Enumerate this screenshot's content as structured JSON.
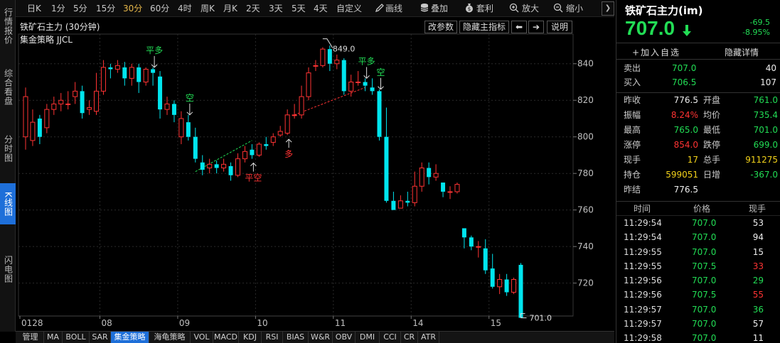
{
  "left_tabs": [
    "行情报价",
    "综合看盘",
    "分时图",
    "K线图",
    "闪电图"
  ],
  "left_tabs_active": 3,
  "toolbar": {
    "periods": [
      "日K",
      "1分",
      "5分",
      "15分",
      "30分",
      "60分",
      "4时",
      "周K",
      "月K",
      "2天",
      "3天",
      "5天",
      "4天",
      "自定义"
    ],
    "active_period": "30分",
    "draw": "画线",
    "overlay": "叠加",
    "template": "套利",
    "zoom_in": "放大",
    "zoom_out": "缩小",
    "icons": [
      "pencil-icon",
      "database-icon",
      "moneybag-icon",
      "zoom-in-icon",
      "zoom-out-icon"
    ]
  },
  "chart_header": {
    "title": "铁矿石主力 (30分钟)",
    "strategy": "集金策略 JJCL",
    "change_params": "改参数",
    "hide_indicator": "隐藏主指标",
    "help": "说明"
  },
  "chart_data": {
    "type": "candlestick",
    "y_ticks": [
      720.0,
      740.0,
      760.0,
      780.0,
      800.0,
      820.0,
      840.0
    ],
    "ylim": [
      702,
      850
    ],
    "x_ticks": [
      {
        "label": "0128",
        "index": 0
      },
      {
        "label": "08",
        "index": 11
      },
      {
        "label": "09",
        "index": 22
      },
      {
        "label": "10",
        "index": 33
      },
      {
        "label": "11",
        "index": 44
      },
      {
        "label": "14",
        "index": 55
      },
      {
        "label": "15",
        "index": 66
      }
    ],
    "candles": [
      [
        800,
        822,
        827,
        793
      ],
      [
        798,
        808,
        815,
        795
      ],
      [
        810,
        800,
        812,
        796
      ],
      [
        805,
        815,
        818,
        802
      ],
      [
        815,
        818,
        822,
        812
      ],
      [
        818,
        820,
        824,
        814
      ],
      [
        818,
        818,
        825,
        815
      ],
      [
        822,
        825,
        830,
        818
      ],
      [
        825,
        813,
        828,
        810
      ],
      [
        815,
        816,
        820,
        812
      ],
      [
        814,
        825,
        835,
        812
      ],
      [
        825,
        838,
        842,
        823
      ],
      [
        838,
        837,
        840,
        832
      ],
      [
        837,
        839,
        842,
        835
      ],
      [
        838,
        832,
        841,
        828
      ],
      [
        832,
        838,
        840,
        828
      ],
      [
        838,
        830,
        840,
        824
      ],
      [
        830,
        837,
        838,
        828
      ],
      [
        837,
        835,
        838,
        828
      ],
      [
        833,
        815,
        836,
        810
      ],
      [
        815,
        818,
        822,
        812
      ],
      [
        818,
        812,
        820,
        808
      ],
      [
        800,
        810,
        814,
        796
      ],
      [
        808,
        800,
        812,
        798
      ],
      [
        800,
        788,
        805,
        786
      ],
      [
        786,
        782,
        790,
        779
      ],
      [
        783,
        785,
        788,
        780
      ],
      [
        785,
        783,
        787,
        780
      ],
      [
        783,
        785,
        788,
        781
      ],
      [
        784,
        779,
        786,
        776
      ],
      [
        779,
        788,
        791,
        778
      ],
      [
        788,
        792,
        795,
        786
      ],
      [
        793,
        790,
        796,
        788
      ],
      [
        790,
        796,
        797,
        789
      ],
      [
        796,
        795,
        800,
        793
      ],
      [
        797,
        800,
        802,
        795
      ],
      [
        801,
        803,
        806,
        800
      ],
      [
        802,
        812,
        815,
        801
      ],
      [
        812,
        812,
        818,
        810
      ],
      [
        812,
        822,
        828,
        810
      ],
      [
        822,
        835,
        838,
        820
      ],
      [
        839,
        839,
        842,
        836
      ],
      [
        839,
        848,
        849,
        838
      ],
      [
        848,
        840,
        850,
        836
      ],
      [
        840,
        842,
        845,
        837
      ],
      [
        842,
        825,
        843,
        823
      ],
      [
        825,
        830,
        834,
        822
      ],
      [
        830,
        830,
        836,
        828
      ],
      [
        830,
        828,
        832,
        825
      ],
      [
        827,
        825,
        832,
        823
      ],
      [
        825,
        800,
        826,
        798
      ],
      [
        800,
        765,
        816,
        764
      ],
      [
        765,
        760,
        770,
        761
      ],
      [
        761,
        765,
        768,
        762
      ],
      [
        765,
        764,
        770,
        762
      ],
      [
        764,
        773,
        781,
        762
      ],
      [
        773,
        783,
        786,
        770
      ],
      [
        783,
        778,
        786,
        774
      ],
      [
        778,
        780,
        785,
        776
      ],
      [
        775,
        770,
        775,
        767
      ],
      [
        770,
        770,
        773,
        766
      ],
      [
        770,
        774,
        775,
        769
      ],
      [
        750,
        745,
        750,
        739
      ],
      [
        745,
        740,
        746,
        738
      ],
      [
        740,
        740,
        743,
        734
      ],
      [
        739,
        727,
        744,
        725
      ],
      [
        728,
        718,
        736,
        717
      ],
      [
        718,
        722,
        725,
        714
      ],
      [
        722,
        715,
        725,
        713
      ],
      [
        715,
        722,
        723,
        714
      ],
      [
        730,
        701,
        731,
        701
      ]
    ],
    "signals": [
      {
        "label": "平多",
        "index": 18,
        "price": 842,
        "type": "sell",
        "color": "#22dd55"
      },
      {
        "label": "空",
        "index": 23,
        "price": 807,
        "type": "sell",
        "color": "#22dd55"
      },
      {
        "label": "平空",
        "index": 32,
        "price": 788,
        "type": "buy",
        "color": "#ff3333"
      },
      {
        "label": "多",
        "index": 37,
        "price": 798,
        "type": "buy",
        "color": "#ff3333"
      },
      {
        "label": "平多",
        "index": 48,
        "price": 840,
        "type": "sell",
        "color": "#22dd55"
      },
      {
        "label": "空",
        "index": 50,
        "price": 812,
        "type": "sell",
        "color": "#22dd55"
      }
    ],
    "high_label": "849.0",
    "low_label": "701.0",
    "colors": {
      "up": "#ff3333",
      "down": "#00e5ee",
      "grid": "#2a2a2a",
      "axis_text": "#c0c0c0"
    }
  },
  "bottom_tabs": [
    "管理",
    "MA",
    "BOLL",
    "SAR",
    "集金策略",
    "海龟策略",
    "VOL",
    "MACD",
    "KDJ",
    "RSI",
    "BIAS",
    "W&R",
    "OBV",
    "DMI",
    "CCI",
    "CR",
    "ATR"
  ],
  "bottom_tabs_active": 4,
  "quote": {
    "name": "铁矿石主力(im)",
    "price": "707.0",
    "change": "-69.5",
    "change_pct": "-8.95%",
    "add_watch": "+加入自选",
    "hide_detail": "隐藏详情",
    "sell_label": "卖出",
    "sell_price": "707.0",
    "sell_vol": "40",
    "buy_label": "买入",
    "buy_price": "706.5",
    "buy_vol": "107",
    "stats": [
      {
        "l1": "昨收",
        "v1": "776.5",
        "c1": "white",
        "l2": "开盘",
        "v2": "761.0",
        "c2": "green"
      },
      {
        "l1": "振幅",
        "v1": "8.24%",
        "c1": "red",
        "l2": "均价",
        "v2": "735.4",
        "c2": "green"
      },
      {
        "l1": "最高",
        "v1": "765.0",
        "c1": "green",
        "l2": "最低",
        "v2": "701.0",
        "c2": "green"
      },
      {
        "l1": "涨停",
        "v1": "854.0",
        "c1": "red",
        "l2": "跌停",
        "v2": "699.0",
        "c2": "green"
      },
      {
        "l1": "现手",
        "v1": "17",
        "c1": "yellow",
        "l2": "总手",
        "v2": "911275",
        "c2": "yellow"
      },
      {
        "l1": "持仓",
        "v1": "599051",
        "c1": "yellow",
        "l2": "日增",
        "v2": "-367.0",
        "c2": "green"
      },
      {
        "l1": "昨结",
        "v1": "776.5",
        "c1": "white",
        "l2": "",
        "v2": "",
        "c2": "white"
      }
    ],
    "ticks_header": {
      "time": "时间",
      "price": "价格",
      "vol": "现手"
    },
    "ticks": [
      {
        "time": "11:29:54",
        "price": "707.0",
        "vol": "53",
        "vc": "white"
      },
      {
        "time": "11:29:54",
        "price": "707.0",
        "vol": "94",
        "vc": "white"
      },
      {
        "time": "11:29:55",
        "price": "707.0",
        "vol": "15",
        "vc": "white"
      },
      {
        "time": "11:29:55",
        "price": "707.5",
        "vol": "33",
        "vc": "red"
      },
      {
        "time": "11:29:56",
        "price": "707.0",
        "vol": "29",
        "vc": "green"
      },
      {
        "time": "11:29:56",
        "price": "707.5",
        "vol": "55",
        "vc": "red"
      },
      {
        "time": "11:29:57",
        "price": "707.0",
        "vol": "36",
        "vc": "green"
      },
      {
        "time": "11:29:57",
        "price": "707.0",
        "vol": "57",
        "vc": "white"
      },
      {
        "time": "11:29:58",
        "price": "707.0",
        "vol": "11",
        "vc": "white"
      }
    ]
  }
}
